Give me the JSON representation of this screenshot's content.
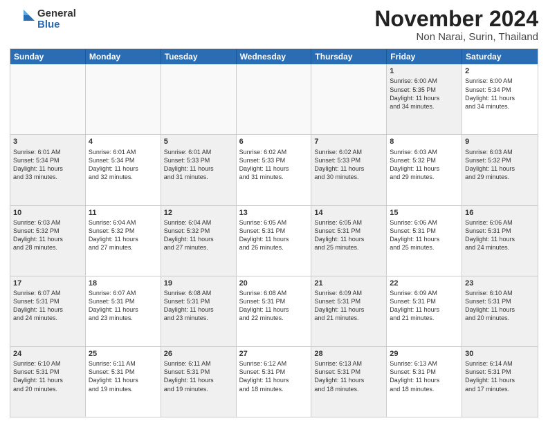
{
  "logo": {
    "general": "General",
    "blue": "Blue"
  },
  "title": {
    "month": "November 2024",
    "location": "Non Narai, Surin, Thailand"
  },
  "header_days": [
    "Sunday",
    "Monday",
    "Tuesday",
    "Wednesday",
    "Thursday",
    "Friday",
    "Saturday"
  ],
  "weeks": [
    [
      {
        "day": "",
        "text": "",
        "empty": true
      },
      {
        "day": "",
        "text": "",
        "empty": true
      },
      {
        "day": "",
        "text": "",
        "empty": true
      },
      {
        "day": "",
        "text": "",
        "empty": true
      },
      {
        "day": "",
        "text": "",
        "empty": true
      },
      {
        "day": "1",
        "text": "Sunrise: 6:00 AM\nSunset: 5:35 PM\nDaylight: 11 hours\nand 34 minutes.",
        "shaded": true
      },
      {
        "day": "2",
        "text": "Sunrise: 6:00 AM\nSunset: 5:34 PM\nDaylight: 11 hours\nand 34 minutes.",
        "shaded": false
      }
    ],
    [
      {
        "day": "3",
        "text": "Sunrise: 6:01 AM\nSunset: 5:34 PM\nDaylight: 11 hours\nand 33 minutes.",
        "shaded": true
      },
      {
        "day": "4",
        "text": "Sunrise: 6:01 AM\nSunset: 5:34 PM\nDaylight: 11 hours\nand 32 minutes.",
        "shaded": false
      },
      {
        "day": "5",
        "text": "Sunrise: 6:01 AM\nSunset: 5:33 PM\nDaylight: 11 hours\nand 31 minutes.",
        "shaded": true
      },
      {
        "day": "6",
        "text": "Sunrise: 6:02 AM\nSunset: 5:33 PM\nDaylight: 11 hours\nand 31 minutes.",
        "shaded": false
      },
      {
        "day": "7",
        "text": "Sunrise: 6:02 AM\nSunset: 5:33 PM\nDaylight: 11 hours\nand 30 minutes.",
        "shaded": true
      },
      {
        "day": "8",
        "text": "Sunrise: 6:03 AM\nSunset: 5:32 PM\nDaylight: 11 hours\nand 29 minutes.",
        "shaded": false
      },
      {
        "day": "9",
        "text": "Sunrise: 6:03 AM\nSunset: 5:32 PM\nDaylight: 11 hours\nand 29 minutes.",
        "shaded": true
      }
    ],
    [
      {
        "day": "10",
        "text": "Sunrise: 6:03 AM\nSunset: 5:32 PM\nDaylight: 11 hours\nand 28 minutes.",
        "shaded": true
      },
      {
        "day": "11",
        "text": "Sunrise: 6:04 AM\nSunset: 5:32 PM\nDaylight: 11 hours\nand 27 minutes.",
        "shaded": false
      },
      {
        "day": "12",
        "text": "Sunrise: 6:04 AM\nSunset: 5:32 PM\nDaylight: 11 hours\nand 27 minutes.",
        "shaded": true
      },
      {
        "day": "13",
        "text": "Sunrise: 6:05 AM\nSunset: 5:31 PM\nDaylight: 11 hours\nand 26 minutes.",
        "shaded": false
      },
      {
        "day": "14",
        "text": "Sunrise: 6:05 AM\nSunset: 5:31 PM\nDaylight: 11 hours\nand 25 minutes.",
        "shaded": true
      },
      {
        "day": "15",
        "text": "Sunrise: 6:06 AM\nSunset: 5:31 PM\nDaylight: 11 hours\nand 25 minutes.",
        "shaded": false
      },
      {
        "day": "16",
        "text": "Sunrise: 6:06 AM\nSunset: 5:31 PM\nDaylight: 11 hours\nand 24 minutes.",
        "shaded": true
      }
    ],
    [
      {
        "day": "17",
        "text": "Sunrise: 6:07 AM\nSunset: 5:31 PM\nDaylight: 11 hours\nand 24 minutes.",
        "shaded": true
      },
      {
        "day": "18",
        "text": "Sunrise: 6:07 AM\nSunset: 5:31 PM\nDaylight: 11 hours\nand 23 minutes.",
        "shaded": false
      },
      {
        "day": "19",
        "text": "Sunrise: 6:08 AM\nSunset: 5:31 PM\nDaylight: 11 hours\nand 23 minutes.",
        "shaded": true
      },
      {
        "day": "20",
        "text": "Sunrise: 6:08 AM\nSunset: 5:31 PM\nDaylight: 11 hours\nand 22 minutes.",
        "shaded": false
      },
      {
        "day": "21",
        "text": "Sunrise: 6:09 AM\nSunset: 5:31 PM\nDaylight: 11 hours\nand 21 minutes.",
        "shaded": true
      },
      {
        "day": "22",
        "text": "Sunrise: 6:09 AM\nSunset: 5:31 PM\nDaylight: 11 hours\nand 21 minutes.",
        "shaded": false
      },
      {
        "day": "23",
        "text": "Sunrise: 6:10 AM\nSunset: 5:31 PM\nDaylight: 11 hours\nand 20 minutes.",
        "shaded": true
      }
    ],
    [
      {
        "day": "24",
        "text": "Sunrise: 6:10 AM\nSunset: 5:31 PM\nDaylight: 11 hours\nand 20 minutes.",
        "shaded": true
      },
      {
        "day": "25",
        "text": "Sunrise: 6:11 AM\nSunset: 5:31 PM\nDaylight: 11 hours\nand 19 minutes.",
        "shaded": false
      },
      {
        "day": "26",
        "text": "Sunrise: 6:11 AM\nSunset: 5:31 PM\nDaylight: 11 hours\nand 19 minutes.",
        "shaded": true
      },
      {
        "day": "27",
        "text": "Sunrise: 6:12 AM\nSunset: 5:31 PM\nDaylight: 11 hours\nand 18 minutes.",
        "shaded": false
      },
      {
        "day": "28",
        "text": "Sunrise: 6:13 AM\nSunset: 5:31 PM\nDaylight: 11 hours\nand 18 minutes.",
        "shaded": true
      },
      {
        "day": "29",
        "text": "Sunrise: 6:13 AM\nSunset: 5:31 PM\nDaylight: 11 hours\nand 18 minutes.",
        "shaded": false
      },
      {
        "day": "30",
        "text": "Sunrise: 6:14 AM\nSunset: 5:31 PM\nDaylight: 11 hours\nand 17 minutes.",
        "shaded": true
      }
    ]
  ]
}
